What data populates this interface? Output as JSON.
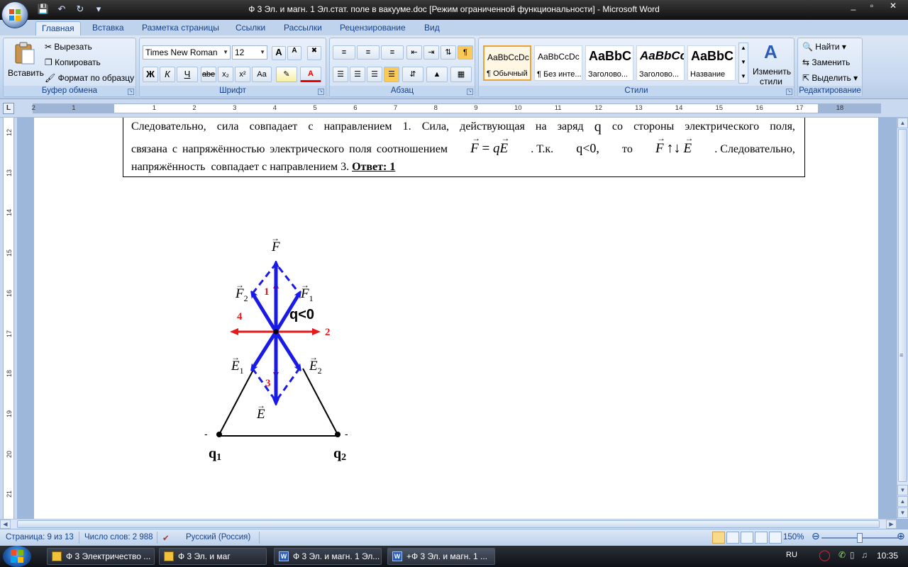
{
  "window": {
    "title": "Ф 3 Эл. и магн. 1 Эл.стат. поле в вакууме.doc [Режим ограниченной функциональности] - Microsoft Word",
    "minimize": "_",
    "maximize": "▫",
    "close": "✕"
  },
  "tabs": [
    "Главная",
    "Вставка",
    "Разметка страницы",
    "Ссылки",
    "Рассылки",
    "Рецензирование",
    "Вид"
  ],
  "ribbon": {
    "clipboard": {
      "label": "Буфер обмена",
      "paste": "Вставить",
      "cut": "Вырезать",
      "copy": "Копировать",
      "format_painter": "Формат по образцу"
    },
    "font": {
      "label": "Шрифт",
      "font_name": "Times New Roman",
      "font_size": "12",
      "bold": "Ж",
      "italic": "К",
      "underline": "Ч",
      "strike": "abe",
      "subscript": "x₂",
      "superscript": "x²",
      "case": "Aa",
      "grow": "A",
      "shrink": "A",
      "color": "A"
    },
    "paragraph": {
      "label": "Абзац"
    },
    "styles": {
      "label": "Стили",
      "tiles": [
        {
          "sample": "AaBbCcDc",
          "name": "¶ Обычный"
        },
        {
          "sample": "AaBbCcDc",
          "name": "¶ Без инте..."
        },
        {
          "sample": "AaBbC",
          "name": "Заголово..."
        },
        {
          "sample": "AaBbCc",
          "name": "Заголово..."
        },
        {
          "sample": "AaBbC",
          "name": "Название"
        }
      ],
      "change_styles_1": "Изменить",
      "change_styles_2": "стили"
    },
    "editing": {
      "label": "Редактирование",
      "find": "Найти",
      "replace": "Заменить",
      "select": "Выделить"
    }
  },
  "ruler": {
    "corner": "L",
    "h_ticks": [
      "2",
      "1",
      "1",
      "2",
      "3",
      "4",
      "5",
      "6",
      "7",
      "8",
      "9",
      "10",
      "11",
      "12",
      "13",
      "14",
      "15",
      "16",
      "17",
      "18"
    ],
    "v_ticks": [
      "12",
      "13",
      "14",
      "15",
      "16",
      "17",
      "18",
      "19",
      "20",
      "21"
    ]
  },
  "document": {
    "line1_words": [
      "Следовательно,",
      "сила",
      "совпадает",
      "с",
      "направлением",
      "1.",
      "Сила,",
      "действующая",
      "на",
      "заряд",
      "q",
      "со",
      "стороны",
      "электрического",
      "поля,"
    ],
    "line2_a": "связана с напряжённостью электрического поля соотношением",
    "line2_eq_f": "F",
    "line2_eq_eq": " = ",
    "line2_eq_q": "q",
    "line2_eq_e": "E",
    "line2_b": ". Т.к.",
    "line2_qlt": "q<0,",
    "line2_c": "то",
    "line2_arrows": "↑↓",
    "line2_d": ". Следовательно,",
    "line3_text": "напряжённость  совпадает с направлением 3.",
    "answer": "Ответ: 1"
  },
  "figure": {
    "label_F": "F",
    "label_F1": "F",
    "label_F1_sub": "1",
    "label_F2": "F",
    "label_F2_sub": "2",
    "label_E": "E",
    "label_E1": "E",
    "label_E1_sub": "1",
    "label_E2": "E",
    "label_E2_sub": "2",
    "num1": "1",
    "num2": "2",
    "num3": "3",
    "num4": "4",
    "charge_label": "q<0",
    "q1": "q",
    "q1_sub": "1",
    "q2": "q",
    "q2_sub": "2",
    "minus": "-",
    "colors": {
      "blue": "#1a1ae6",
      "red": "#e61a1a",
      "black": "#000000"
    }
  },
  "status": {
    "page": "Страница: 9 из 13",
    "words": "Число слов: 2 988",
    "language": "Русский (Россия)",
    "zoom": "150%"
  },
  "taskbar": {
    "buttons": [
      {
        "label": "Ф 3 Электричество ...",
        "icon": "ws"
      },
      {
        "label": "Ф 3 Эл. и маг",
        "icon": "ws"
      },
      {
        "label": "Ф 3 Эл. и магн. 1 Эл...",
        "icon": "W"
      },
      {
        "label": "+Ф 3 Эл. и магн. 1 ...",
        "icon": "W"
      }
    ],
    "lang": "RU",
    "time": "10:35"
  }
}
